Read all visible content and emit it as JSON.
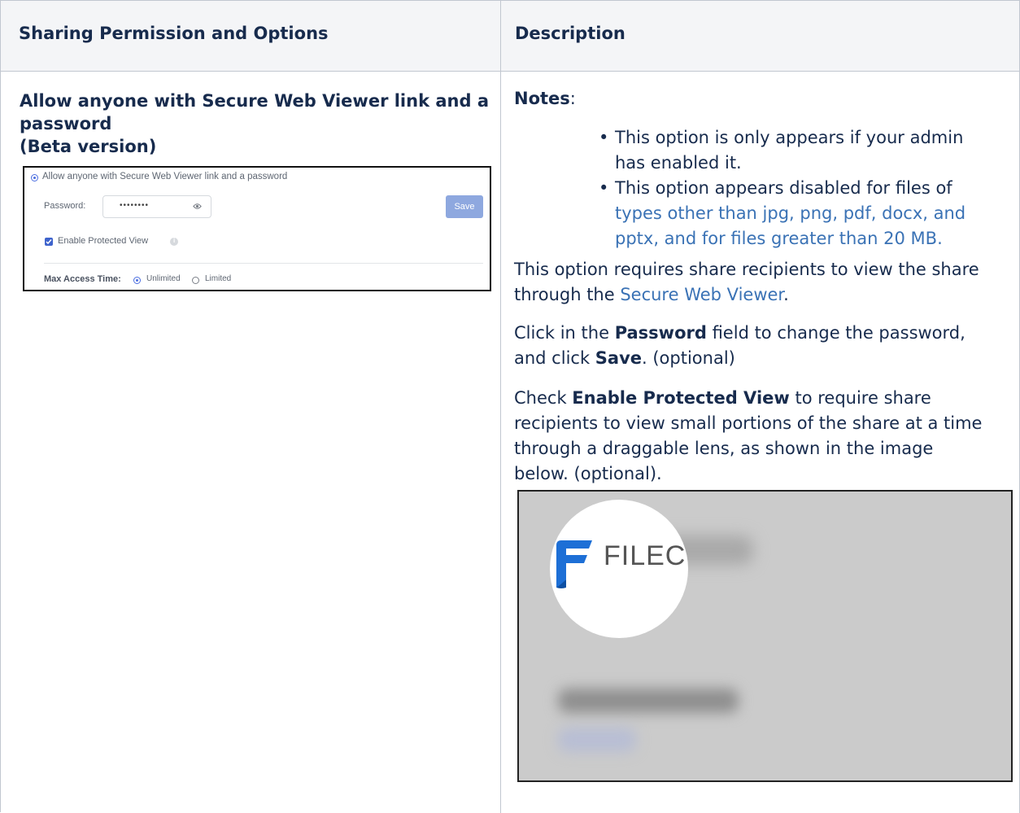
{
  "table": {
    "headers": [
      "Sharing Permission and Options",
      "Description"
    ]
  },
  "left": {
    "title_line1": "Allow anyone with Secure Web Viewer link and a",
    "title_line2": "password",
    "title_line3": "(Beta version)",
    "screenshot": {
      "radio_label": "Allow anyone with Secure Web Viewer link and a password",
      "password_label": "Password:",
      "password_value": "••••••••",
      "save_label": "Save",
      "checkbox_label": "Enable Protected View",
      "checkbox_checked": true,
      "max_access_label": "Max Access Time:",
      "option_unlimited": "Unlimited",
      "option_limited": "Limited",
      "accent_color": "#4b6ee0"
    }
  },
  "right": {
    "notes_label": "Notes",
    "notes_colon": ":",
    "bullet1_line1": "This option is only appears if your admin",
    "bullet1_line2": "has enabled it.",
    "bullet2_line1": "This option appears disabled for files of",
    "bullet2_line2": "types other than jpg, png, pdf, docx, and",
    "bullet2_line3": "pptx, and for files greater than 20 MB.",
    "p1_line1": "This option requires share recipients to view the share",
    "p1_line2_prefix": "through the ",
    "p1_link": "Secure Web Viewer",
    "p1_line2_suffix": ".",
    "p2_line1_prefix": "Click in the ",
    "p2_line1_bold": "Password",
    "p2_line1_suffix": " field to change the password,",
    "p2_line2_prefix": "and click ",
    "p2_line2_bold": "Save",
    "p2_line2_suffix": ". (optional)",
    "p3_line1_prefix": "Check ",
    "p3_line1_bold": "Enable Protected View",
    "p3_line1_suffix": " to require share",
    "p3_line2": "recipients to view small portions of the share at a time",
    "p3_line3": "through a draggable lens, as shown in the image",
    "p3_line4": "below. (optional).",
    "lens_logo_text": "FILECL"
  }
}
